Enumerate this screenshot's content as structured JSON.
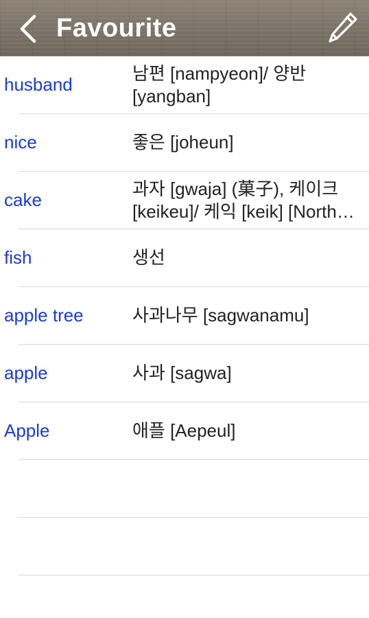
{
  "header": {
    "title": "Favourite",
    "back_icon": "chevron-left-icon",
    "edit_icon": "pencil-icon"
  },
  "colors": {
    "term_text": "#1a3bd6",
    "meaning_text": "#222222",
    "header_text": "#ffffff"
  },
  "favourites": [
    {
      "term": "husband",
      "meaning": "남편 [nampyeon]/ 양반 [yangban]"
    },
    {
      "term": "nice",
      "meaning": "좋은 [joheun]"
    },
    {
      "term": "cake",
      "meaning": "과자 [gwaja] (菓子), 케이크 [keikeu]/ 케익 [keik] [North Korea]"
    },
    {
      "term": "fish",
      "meaning": "생선"
    },
    {
      "term": "apple tree",
      "meaning": "사과나무 [sagwanamu]"
    },
    {
      "term": "apple",
      "meaning": "사과 [sagwa]"
    },
    {
      "term": "Apple",
      "meaning": "애플 [Aepeul]"
    }
  ]
}
